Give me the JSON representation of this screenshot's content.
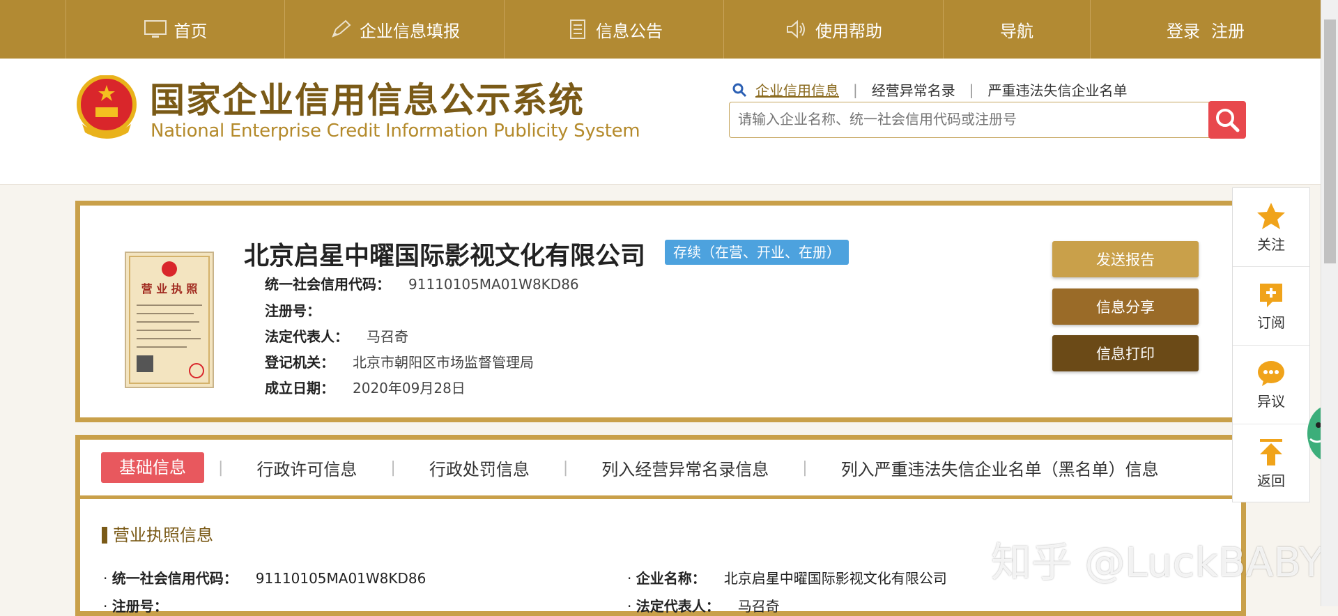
{
  "nav": {
    "items": [
      {
        "label": "首页",
        "icon": "monitor-icon"
      },
      {
        "label": "企业信息填报",
        "icon": "pen-icon"
      },
      {
        "label": "信息公告",
        "icon": "document-icon"
      },
      {
        "label": "使用帮助",
        "icon": "speaker-icon"
      },
      {
        "label": "导航",
        "icon": ""
      }
    ],
    "login": "登录",
    "register": "注册"
  },
  "header": {
    "title_cn": "国家企业信用信息公示系统",
    "title_en": "National Enterprise Credit Information Publicity System",
    "search_links": [
      "企业信用信息",
      "经营异常名录",
      "严重违法失信企业名单"
    ],
    "search_placeholder": "请输入企业名称、统一社会信用代码或注册号"
  },
  "company": {
    "name": "北京启星中曜国际影视文化有限公司",
    "status": "存续（在营、开业、在册）",
    "fields": [
      {
        "label": "统一社会信用代码：",
        "value": "91110105MA01W8KD86"
      },
      {
        "label": "注册号：",
        "value": ""
      },
      {
        "label": "法定代表人：",
        "value": "马召奇"
      },
      {
        "label": "登记机关：",
        "value": "北京市朝阳区市场监督管理局"
      },
      {
        "label": "成立日期：",
        "value": "2020年09月28日"
      }
    ],
    "buttons": {
      "send": "发送报告",
      "share": "信息分享",
      "print": "信息打印"
    },
    "license_text": "营 业 执 照"
  },
  "tabs": [
    "基础信息",
    "行政许可信息",
    "行政处罚信息",
    "列入经营异常名录信息",
    "列入严重违法失信企业名单（黑名单）信息"
  ],
  "basic": {
    "section": "营业执照信息",
    "credit_label": "统一社会信用代码：",
    "credit_value": "91110105MA01W8KD86",
    "name_label": "企业名称：",
    "name_value": "北京启星中曜国际影视文化有限公司",
    "reg_label": "注册号：",
    "legal_label": "法定代表人：",
    "legal_value": "马召奇"
  },
  "side": {
    "follow": "关注",
    "subscribe": "订阅",
    "objection": "异议",
    "back": "返回"
  },
  "watermark": "知乎 @LuckBABY",
  "colors": {
    "gold": "#b28a33",
    "border": "#c9a04a",
    "tab_active": "#e8585e",
    "status": "#4da2de",
    "search": "#e8484d"
  }
}
